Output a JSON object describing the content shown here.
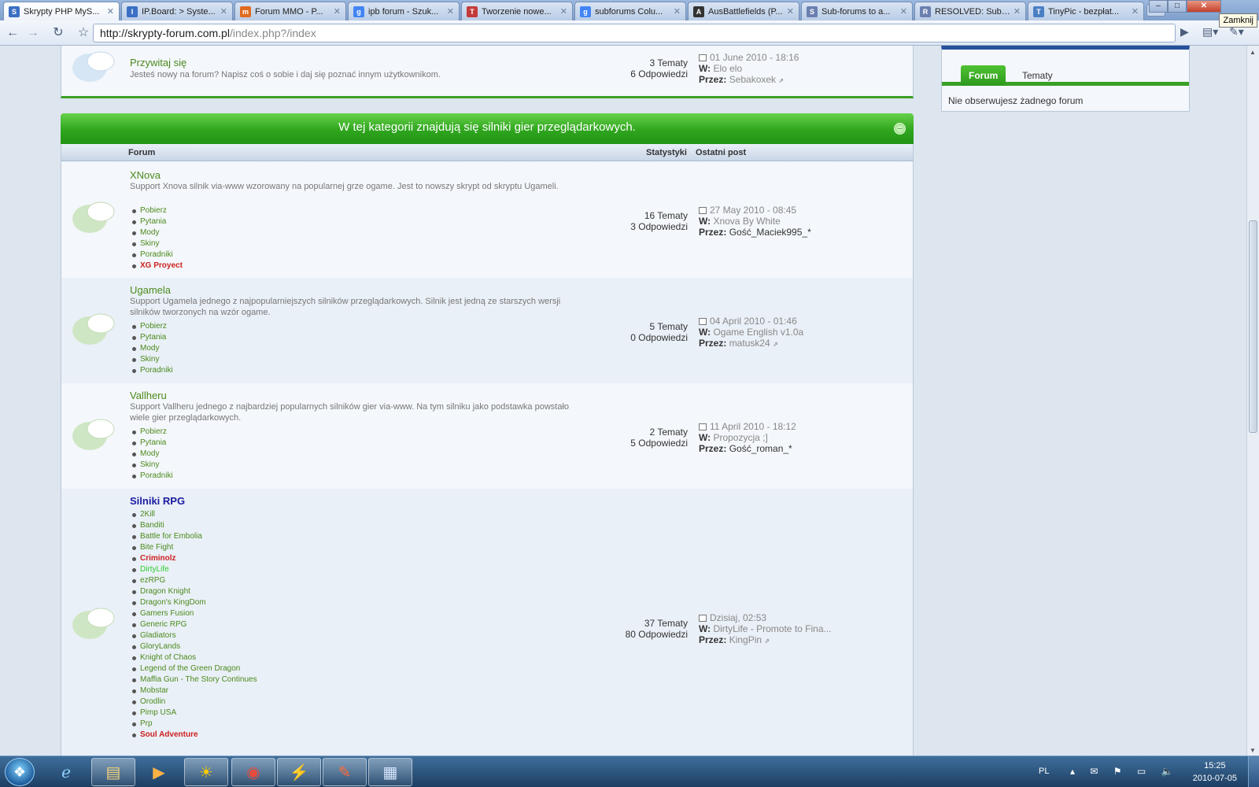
{
  "browser": {
    "tabs": [
      {
        "title": "Skrypty PHP MyS...",
        "icon_color": "#3a6fc4",
        "icon_glyph": "S"
      },
      {
        "title": "IP.Board: > Syste...",
        "icon_color": "#3a6fc4",
        "icon_glyph": "I"
      },
      {
        "title": "Forum MMO - P...",
        "icon_color": "#e06b1f",
        "icon_glyph": "m"
      },
      {
        "title": "ipb forum - Szuk...",
        "icon_color": "#4285f4",
        "icon_glyph": "g"
      },
      {
        "title": "Tworzenie nowe...",
        "icon_color": "#c43a3a",
        "icon_glyph": "T"
      },
      {
        "title": "subforums Colu...",
        "icon_color": "#4285f4",
        "icon_glyph": "g"
      },
      {
        "title": "AusBattlefields (P...",
        "icon_color": "#333333",
        "icon_glyph": "A"
      },
      {
        "title": "Sub-forums to a...",
        "icon_color": "#6b7fb0",
        "icon_glyph": "S"
      },
      {
        "title": "RESOLVED: Sub-f...",
        "icon_color": "#6b7fb0",
        "icon_glyph": "R"
      },
      {
        "title": "TinyPic - bezpłat...",
        "icon_color": "#4a7fc4",
        "icon_glyph": "T"
      }
    ],
    "tooltip": "Zamknij",
    "url_host": "http://skrypty-forum.com.pl",
    "url_path": "/index.php?/index"
  },
  "top_forum": {
    "name": "Przywitaj się",
    "desc": "Jesteś nowy na forum? Napisz coś o sobie i daj się poznać innym użytkownikom.",
    "topics": "3 Tematy",
    "replies": "6 Odpowiedzi",
    "date": "01 June 2010 - 18:16",
    "in_label": "W:",
    "in_value": "Elo elo",
    "by_label": "Przez:",
    "by_value": "Sebakoxek"
  },
  "sidebar": {
    "tab_forum": "Forum",
    "tab_topics": "Tematy",
    "empty_text": "Nie obserwujesz żadnego forum"
  },
  "category": {
    "title": "W tej kategorii znajdują się silniki gier przeglądarkowych.",
    "toggle": "–",
    "col_forum": "Forum",
    "col_stats": "Statystyki",
    "col_last": "Ostatni post"
  },
  "forums": {
    "xnova": {
      "name": "XNova",
      "desc": "Support Xnova silnik via-www wzorowany na popularnej grze ogame. Jest to nowszy skrypt od skryptu Ugameli.",
      "subs": [
        "Pobierz",
        "Pytania",
        "Mody",
        "Skiny",
        "Poradniki",
        "XG Proyect"
      ],
      "topics": "16 Tematy",
      "replies": "3 Odpowiedzi",
      "date": "27 May 2010 - 08:45",
      "in_value": "Xnova By White",
      "by_value": "Gość_Maciek995_*"
    },
    "ugamela": {
      "name": "Ugamela",
      "desc": "Support Ugamela jednego z najpopularniejszych silników przeglądarkowych. Silnik jest jedną ze starszych wersji silników tworzonych na wzór ogame.",
      "subs": [
        "Pobierz",
        "Pytania",
        "Mody",
        "Skiny",
        "Poradniki"
      ],
      "topics": "5 Tematy",
      "replies": "0 Odpowiedzi",
      "date": "04 April 2010 - 01:46",
      "in_value": "Ogame English v1.0a",
      "by_value": "matusk24"
    },
    "vallheru": {
      "name": "Vallheru",
      "desc": "Support Vallheru jednego z najbardziej popularnych silników gier via-www. Na tym silniku jako podstawka powstało wiele gier przeglądarkowych.",
      "subs": [
        "Pobierz",
        "Pytania",
        "Mody",
        "Skiny",
        "Poradniki"
      ],
      "topics": "2 Tematy",
      "replies": "5 Odpowiedzi",
      "date": "11 April 2010 - 18:12",
      "in_value": "Propozycja ;]",
      "by_value": "Gość_roman_*"
    },
    "rpg": {
      "name": "Silniki RPG",
      "subs": [
        "2Kill",
        "Banditi",
        "Battle for Embolia",
        "Bite Fight",
        "Criminolz",
        "DirtyLife",
        "ezRPG",
        "Dragon Knight",
        "Dragon's KingDom",
        "Gamers Fusion",
        "Generic RPG",
        "Gladiators",
        "GloryLands",
        "Knight of Chaos",
        "Legend of the Green Dragon",
        "Maffia Gun - The Story Continues",
        "Mobstar",
        "Orodlin",
        "Pimp USA",
        "Prp",
        "Soul Adventure"
      ],
      "topics": "37 Tematy",
      "replies": "80 Odpowiedzi",
      "date": "Dzisiaj, 02:53",
      "in_value": "DirtyLife - Promote to Fina...",
      "by_value": "KingPin"
    }
  },
  "taskbar": {
    "lang": "PL",
    "time": "15:25",
    "date": "2010-07-05"
  },
  "colors": {
    "accent_green": "#2fa51e",
    "link_green": "#4b8a1c",
    "category_blue": "#1a1aa0",
    "highlight_red": "#cc1f1f"
  }
}
